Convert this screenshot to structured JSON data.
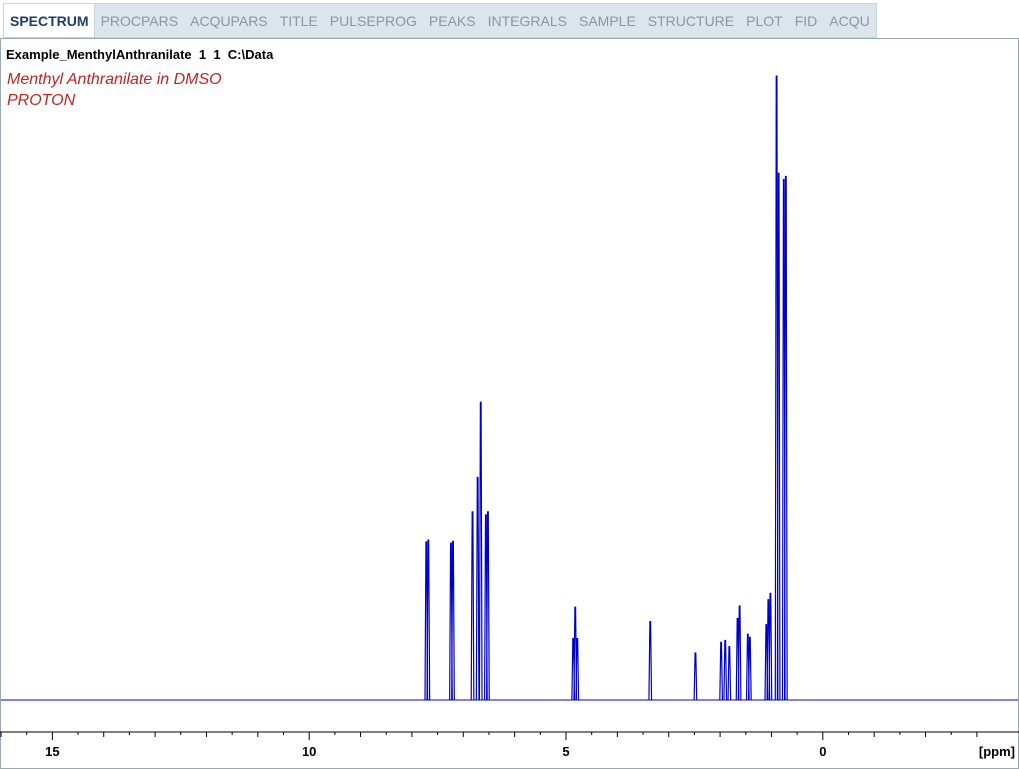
{
  "tabs": [
    {
      "label": "SPECTRUM",
      "active": true
    },
    {
      "label": "PROCPARS",
      "active": false
    },
    {
      "label": "ACQUPARS",
      "active": false
    },
    {
      "label": "TITLE",
      "active": false
    },
    {
      "label": "PULSEPROG",
      "active": false
    },
    {
      "label": "PEAKS",
      "active": false
    },
    {
      "label": "INTEGRALS",
      "active": false
    },
    {
      "label": "SAMPLE",
      "active": false
    },
    {
      "label": "STRUCTURE",
      "active": false
    },
    {
      "label": "PLOT",
      "active": false
    },
    {
      "label": "FID",
      "active": false
    },
    {
      "label": "ACQU",
      "active": false
    }
  ],
  "dataset_label": "Example_MenthylAnthranilate  1  1  C:\\Data",
  "title_lines": [
    "Menthyl Anthranilate in DMSO",
    "PROTON"
  ],
  "colors": {
    "spectrum": "#0000cc",
    "title": "#c8221f",
    "active_tab": "#1f3d66"
  },
  "chart_data": {
    "type": "line",
    "x_unit_label": "[ppm]",
    "x_reversed": true,
    "xlim": [
      16.0,
      -3.8
    ],
    "major_ticks": [
      15,
      10,
      5,
      0
    ],
    "minor_tick_step": 1,
    "peaks": [
      {
        "ppm": 7.72,
        "height": 0.252
      },
      {
        "ppm": 7.68,
        "height": 0.255
      },
      {
        "ppm": 7.24,
        "height": 0.25
      },
      {
        "ppm": 7.2,
        "height": 0.253
      },
      {
        "ppm": 6.82,
        "height": 0.3
      },
      {
        "ppm": 6.72,
        "height": 0.355
      },
      {
        "ppm": 6.66,
        "height": 0.475
      },
      {
        "ppm": 6.56,
        "height": 0.295
      },
      {
        "ppm": 6.52,
        "height": 0.3
      },
      {
        "ppm": 4.86,
        "height": 0.098
      },
      {
        "ppm": 4.82,
        "height": 0.148
      },
      {
        "ppm": 4.78,
        "height": 0.098
      },
      {
        "ppm": 3.36,
        "height": 0.125
      },
      {
        "ppm": 2.48,
        "height": 0.075
      },
      {
        "ppm": 1.98,
        "height": 0.092
      },
      {
        "ppm": 1.9,
        "height": 0.095
      },
      {
        "ppm": 1.82,
        "height": 0.085
      },
      {
        "ppm": 1.66,
        "height": 0.13
      },
      {
        "ppm": 1.62,
        "height": 0.15
      },
      {
        "ppm": 1.46,
        "height": 0.105
      },
      {
        "ppm": 1.42,
        "height": 0.1
      },
      {
        "ppm": 1.1,
        "height": 0.12
      },
      {
        "ppm": 1.06,
        "height": 0.16
      },
      {
        "ppm": 1.02,
        "height": 0.17
      },
      {
        "ppm": 0.9,
        "height": 0.995
      },
      {
        "ppm": 0.86,
        "height": 0.84
      },
      {
        "ppm": 0.76,
        "height": 0.83
      },
      {
        "ppm": 0.72,
        "height": 0.835
      }
    ]
  }
}
